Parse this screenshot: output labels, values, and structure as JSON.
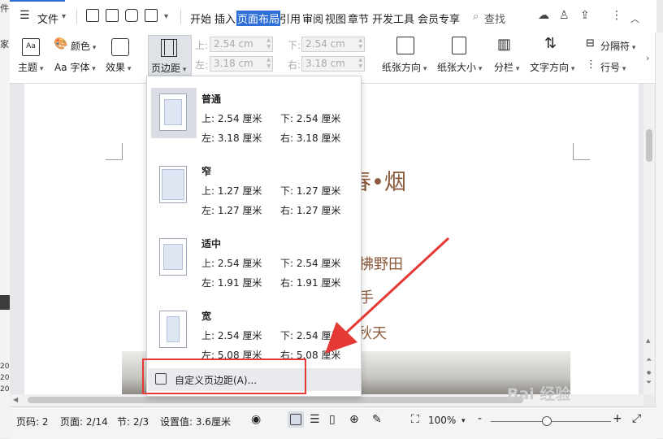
{
  "menubar": {
    "file_label": "文件",
    "tabs": [
      "开始",
      "插入",
      "页面布局",
      "引用",
      "审阅",
      "视图",
      "章节",
      "开发工具",
      "会员专享"
    ],
    "active_tab": "页面布局",
    "search_label": "查找"
  },
  "left_strip": {
    "top_glyph": "件",
    "mid_glyph": "家",
    "marks": [
      "20",
      "20",
      "20"
    ]
  },
  "ribbon": {
    "theme_label": "主题",
    "color_label": "颜色",
    "font_label": "Aa 字体",
    "effect_label": "效果",
    "margin_label": "页边距",
    "top_label": "上:",
    "top_value": "2.54 cm",
    "bottom_label": "下:",
    "bottom_value": "2.54 cm",
    "left_label": "左:",
    "left_value": "3.18 cm",
    "right_label": "右:",
    "right_value": "3.18 cm",
    "orientation_label": "纸张方向",
    "size_label": "纸张大小",
    "columns_label": "分栏",
    "text_direction_label": "文字方向",
    "break_label": "分隔符",
    "line_number_label": "行号"
  },
  "margin_presets": [
    {
      "name": "普通",
      "top": "上: 2.54 厘米",
      "bottom": "下: 2.54 厘米",
      "left": "左: 3.18 厘米",
      "right": "右: 3.18 厘米",
      "selected": true
    },
    {
      "name": "窄",
      "top": "上: 1.27 厘米",
      "bottom": "下: 1.27 厘米",
      "left": "左: 1.27 厘米",
      "right": "右: 1.27 厘米",
      "selected": false
    },
    {
      "name": "适中",
      "top": "上: 2.54 厘米",
      "bottom": "下: 2.54 厘米",
      "left": "左: 1.91 厘米",
      "right": "右: 1.91 厘米",
      "selected": false
    },
    {
      "name": "宽",
      "top": "上: 2.54 厘米",
      "bottom": "下: 2.54 厘米",
      "left": "左: 5.08 厘米",
      "right": "右: 5.08 厘米",
      "selected": false
    }
  ],
  "custom_margin_label": "自定义页边距(A)...",
  "document": {
    "title_fragment": "春•烟",
    "line1": "拂野田",
    "line2": "手",
    "line3": "秋天"
  },
  "statusbar": {
    "page_num": "页码: 2",
    "pages": "页面: 2/14",
    "section": "节: 2/3",
    "setting": "设置值: 3.6厘米",
    "zoom": "100%",
    "zoom_minus": "-",
    "zoom_plus": "+"
  },
  "watermark": "Bai 经验",
  "colors": {
    "active_tab_bg": "#2e6fd8",
    "highlight_border": "#e53935",
    "arrow": "#e53935",
    "doc_text": "#8a5a3c"
  }
}
